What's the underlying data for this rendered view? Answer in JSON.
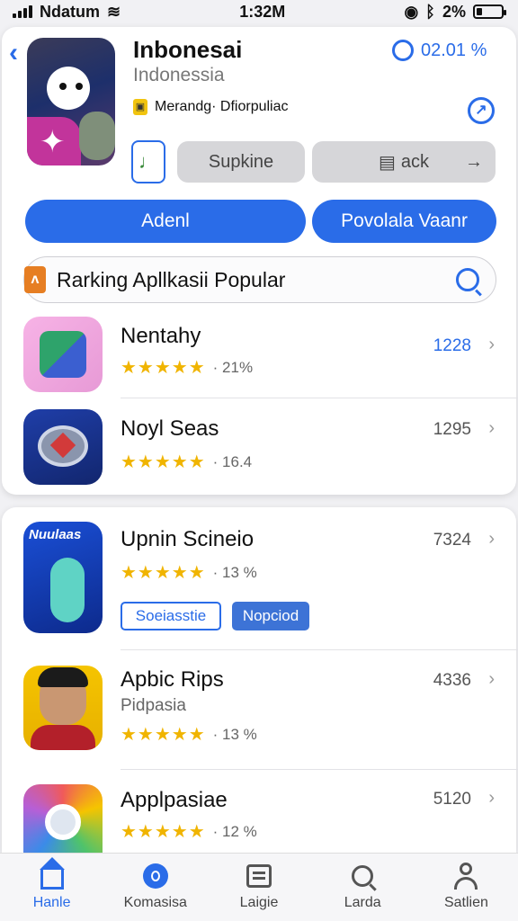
{
  "status": {
    "carrier": "Ndatum",
    "time": "1:32M",
    "battery": "2%",
    "battery_level": 0.22
  },
  "header": {
    "title": "Inbonesai",
    "subtitle": "Indonessia",
    "rank_value": "02.01 %",
    "developer": "Merandg· Dfiorpuliac"
  },
  "actions": {
    "secondary_a": "Supkine",
    "secondary_b": "ack",
    "primary_a": "Adenl",
    "primary_b": "Povolala Vaanr"
  },
  "section": {
    "title": "Rarking Apllkasii Popular"
  },
  "apps": [
    {
      "name": "Nentahy",
      "rating_text": "· 21%",
      "count": "1228",
      "stars": 4.5
    },
    {
      "name": "Noyl Seas",
      "rating_text": "· 16.4",
      "count": "1295",
      "stars": 4.5
    },
    {
      "name": "Upnin Scineio",
      "rating_text": "· 13 %",
      "count": "7324",
      "stars": 4.5,
      "icon_text": "Nuulaas",
      "tags": [
        "Soeiasstie",
        "Nopciod"
      ]
    },
    {
      "name": "Apbic Rips",
      "subtitle": "Pidpasia",
      "rating_text": "· 13 %",
      "count": "4336",
      "stars": 4.5
    },
    {
      "name": "Applpasiae",
      "rating_text": "· 12 %",
      "count": "5120",
      "stars": 4.5
    }
  ],
  "tabs": [
    {
      "label": "Hanle",
      "icon": "home-icon",
      "active": true
    },
    {
      "label": "Komasisa",
      "icon": "discover-icon",
      "active": false
    },
    {
      "label": "Laigie",
      "icon": "list-icon",
      "active": false
    },
    {
      "label": "Larda",
      "icon": "search-icon",
      "active": false
    },
    {
      "label": "Satlien",
      "icon": "person-icon",
      "active": false
    }
  ],
  "colors": {
    "accent": "#2a6ce8",
    "star": "#f0b400"
  }
}
